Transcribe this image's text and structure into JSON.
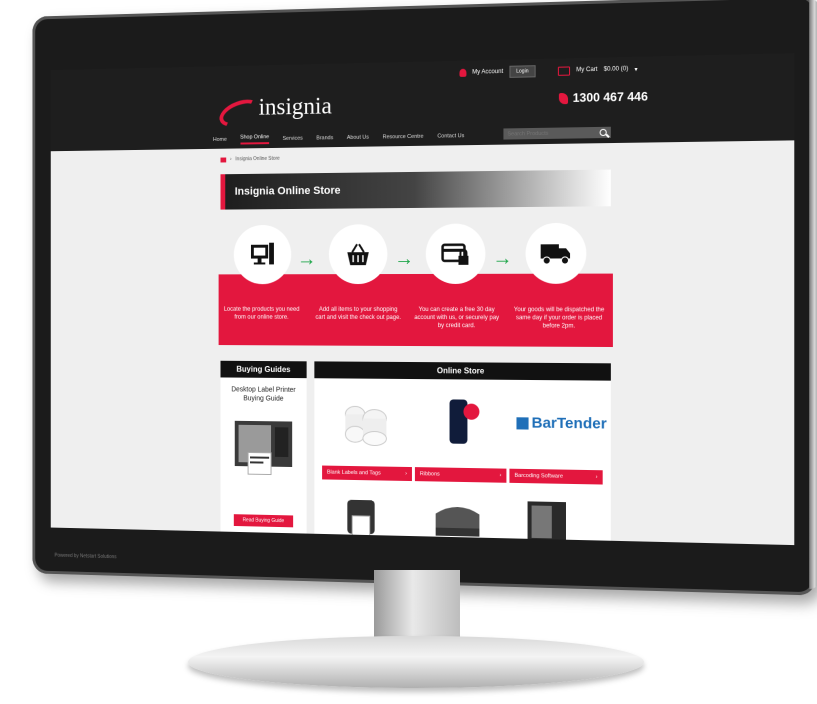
{
  "site": {
    "topbar": {
      "account_label": "My Account",
      "login_label": "Login",
      "cart_label": "My Cart",
      "cart_total": "$0.00 (0)"
    },
    "logo_text": "insignia",
    "phone": "1300 467 446",
    "nav": [
      "Home",
      "Shop Online",
      "Services",
      "Brands",
      "About Us",
      "Resource Centre",
      "Contact Us"
    ],
    "search_placeholder": "Search Products",
    "breadcrumb": "Insignia Online Store",
    "banner_title": "Insignia Online Store",
    "steps": [
      {
        "icon": "computer-cart-icon",
        "text": "Locate the products you need from our online store."
      },
      {
        "icon": "basket-icon",
        "text": "Add all items to your shopping cart and visit the check out page."
      },
      {
        "icon": "credit-card-lock-icon",
        "text": "You can create a free 30 day account with us, or securely pay by credit card."
      },
      {
        "icon": "delivery-truck-icon",
        "text": "Your goods will be dispatched the same day if your order is placed before 2pm."
      }
    ],
    "guides": {
      "heading": "Buying Guides",
      "title": "Desktop Label Printer Buying Guide",
      "button": "Read Buying Guide"
    },
    "online_store": {
      "heading": "Online Store",
      "categories": [
        "Blank Labels and Tags",
        "Ribbons",
        "Barcoding Software"
      ],
      "bartender_logo": "BarTender"
    },
    "footer_text": "Powered by Netstart Solutions"
  },
  "colors": {
    "accent": "#e3173e",
    "header": "#1e1e1e",
    "arrow": "#1fa64a"
  }
}
